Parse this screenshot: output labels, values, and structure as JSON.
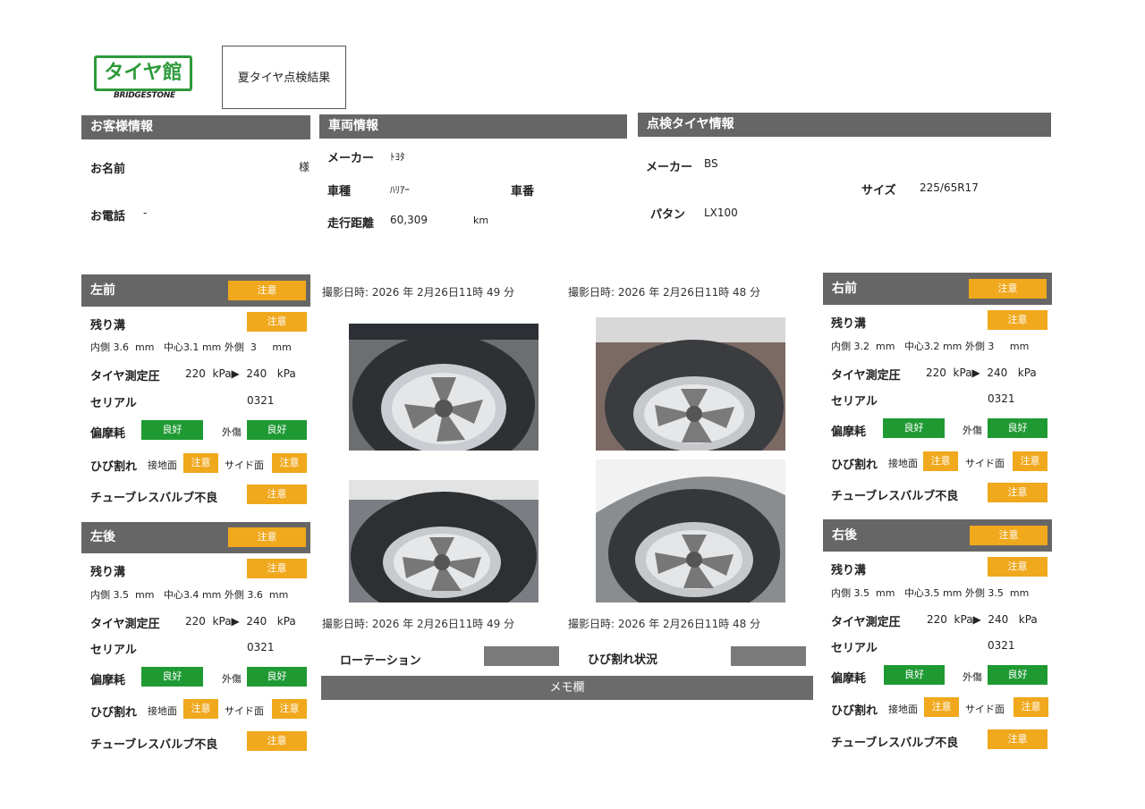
{
  "header": {
    "logo_text": "タイヤ館",
    "logo_sub": "BRIDGESTONE",
    "doc_title": "夏タイヤ点検結果"
  },
  "customer": {
    "section_title": "お客様情報",
    "name_label": "お名前",
    "name_suffix": "様",
    "phone_label": "お電話",
    "phone_value": "-"
  },
  "vehicle": {
    "section_title": "車両情報",
    "maker_label": "メーカー",
    "maker_value": "ﾄﾖﾀ",
    "model_label": "車種",
    "model_value": "ﾊﾘｱｰ",
    "plate_label": "車番",
    "mileage_label": "走行距離",
    "mileage_value": "60,309",
    "mileage_unit": "km"
  },
  "tire_info": {
    "section_title": "点検タイヤ情報",
    "maker_label": "メーカー",
    "maker_value": "BS",
    "size_label": "サイズ",
    "size_value": "225/65R17",
    "pattern_label": "パタン",
    "pattern_value": "LX100"
  },
  "labels": {
    "groove": "残り溝",
    "inner": "内側",
    "center": "中心",
    "outer": "外側",
    "mm": "mm",
    "pressure": "タイヤ測定圧",
    "kpa": "kPa",
    "serial": "セリアル",
    "uneven_wear": "偏摩耗",
    "damage": "外傷",
    "crack": "ひび割れ",
    "contact": "接地面",
    "side": "サイド面",
    "valve": "チューブレスバルブ不良"
  },
  "wheels": {
    "lf": {
      "title": "左前",
      "status": "注意",
      "groove_status": "注意",
      "inner": "3.6",
      "center": "3.1",
      "outer": "3",
      "p1": "220",
      "p2": "240",
      "serial": "0321",
      "wear": "良好",
      "damage": "良好",
      "crack_contact": "注意",
      "crack_side": "注意",
      "valve": "注意"
    },
    "lr": {
      "title": "左後",
      "status": "注意",
      "groove_status": "注意",
      "inner": "3.5",
      "center": "3.4",
      "outer": "3.6",
      "p1": "220",
      "p2": "240",
      "serial": "0321",
      "wear": "良好",
      "damage": "良好",
      "crack_contact": "注意",
      "crack_side": "注意",
      "valve": "注意"
    },
    "rf": {
      "title": "右前",
      "status": "注意",
      "groove_status": "注意",
      "inner": "3.2",
      "center": "3.2",
      "outer": "3",
      "p1": "220",
      "p2": "240",
      "serial": "0321",
      "wear": "良好",
      "damage": "良好",
      "crack_contact": "注意",
      "crack_side": "注意",
      "valve": "注意"
    },
    "rr": {
      "title": "右後",
      "status": "注意",
      "groove_status": "注意",
      "inner": "3.5",
      "center": "3.5",
      "outer": "3.5",
      "p1": "220",
      "p2": "240",
      "serial": "0321",
      "wear": "良好",
      "damage": "良好",
      "crack_contact": "注意",
      "crack_side": "注意",
      "valve": "注意"
    }
  },
  "photos": {
    "caption_tl": "撮影日時: 2026 年 2月26日11時 49 分",
    "caption_tr": "撮影日時: 2026 年 2月26日11時 48 分",
    "caption_bl": "撮影日時: 2026 年 2月26日11時 49 分",
    "caption_br": "撮影日時: 2026 年 2月26日11時 48 分"
  },
  "footer": {
    "rotation_label": "ローテーション",
    "crack_status_label": "ひび割れ状況",
    "memo_label": "メモ欄"
  },
  "colors": {
    "caution": "#f0a81c",
    "good": "#1f9a33",
    "header_gray": "#666666"
  }
}
